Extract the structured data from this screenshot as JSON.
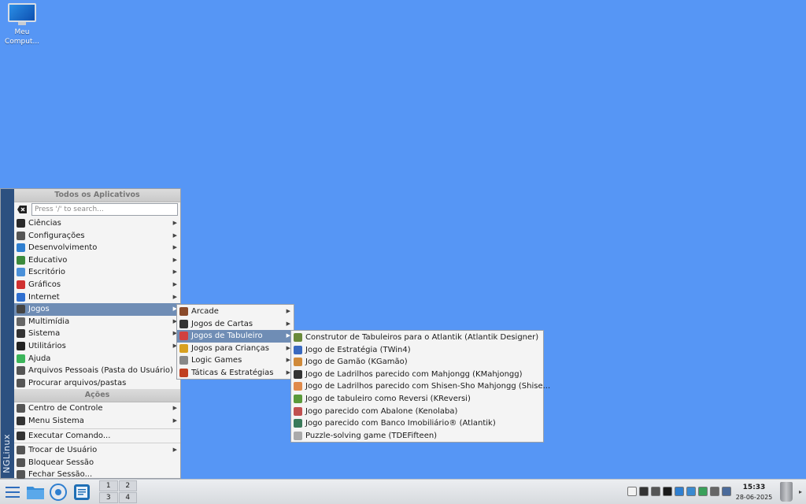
{
  "desktop": {
    "icons": [
      {
        "label": "Meu Comput..."
      }
    ]
  },
  "menu": {
    "brand": "NGLinux",
    "header_apps": "Todos os Aplicativos",
    "search_placeholder": "Press '/' to search...",
    "items": [
      {
        "label": "Ciências",
        "icon": "science-icon",
        "color": "#2a2a2a",
        "submenu": true
      },
      {
        "label": "Configurações",
        "icon": "settings-icon",
        "color": "#555555",
        "submenu": true
      },
      {
        "label": "Desenvolvimento",
        "icon": "development-icon",
        "color": "#2f7fd0",
        "submenu": true
      },
      {
        "label": "Educativo",
        "icon": "education-icon",
        "color": "#3c8a3c",
        "submenu": true
      },
      {
        "label": "Escritório",
        "icon": "office-icon",
        "color": "#4a90d9",
        "submenu": true
      },
      {
        "label": "Gráficos",
        "icon": "graphics-icon",
        "color": "#d03030",
        "submenu": true
      },
      {
        "label": "Internet",
        "icon": "internet-icon",
        "color": "#2f6fd0",
        "submenu": true
      },
      {
        "label": "Jogos",
        "icon": "games-icon",
        "color": "#444444",
        "submenu": true,
        "highlighted": true
      },
      {
        "label": "Multimídia",
        "icon": "multimedia-icon",
        "color": "#666666",
        "submenu": true
      },
      {
        "label": "Sistema",
        "icon": "system-icon",
        "color": "#333333",
        "submenu": true
      },
      {
        "label": "Utilitários",
        "icon": "utilities-icon",
        "color": "#222222",
        "submenu": true
      },
      {
        "label": "Ajuda",
        "icon": "help-icon",
        "color": "#3bb55a",
        "submenu": false
      },
      {
        "label": "Arquivos Pessoais (Pasta do Usuário)",
        "icon": "home-icon",
        "color": "#555555",
        "submenu": false
      },
      {
        "label": "Procurar arquivos/pastas",
        "icon": "find-icon",
        "color": "#555555",
        "submenu": false
      }
    ],
    "header_actions": "Ações",
    "actions": [
      {
        "label": "Centro de Controle",
        "icon": "control-center-icon",
        "color": "#555555",
        "submenu": true
      },
      {
        "label": "Menu Sistema",
        "icon": "system-menu-icon",
        "color": "#333333",
        "submenu": true
      },
      {
        "label": "Executar Comando...",
        "icon": "run-command-icon",
        "color": "#333333",
        "submenu": false
      },
      {
        "label": "Trocar de Usuário",
        "icon": "switch-user-icon",
        "color": "#555555",
        "submenu": true
      },
      {
        "label": "Bloquear Sessão",
        "icon": "lock-icon",
        "color": "#555555",
        "submenu": false
      },
      {
        "label": "Fechar Sessão...",
        "icon": "logout-icon",
        "color": "#555555",
        "submenu": false
      }
    ]
  },
  "games_submenu": [
    {
      "label": "Arcade",
      "icon": "arcade-icon",
      "color": "#8a4a2a"
    },
    {
      "label": "Jogos de Cartas",
      "icon": "cards-icon",
      "color": "#333333"
    },
    {
      "label": "Jogos de Tabuleiro",
      "icon": "board-icon",
      "color": "#d04040",
      "highlighted": true
    },
    {
      "label": "Jogos para Crianças",
      "icon": "kids-icon",
      "color": "#d8a020"
    },
    {
      "label": "Logic Games",
      "icon": "logic-icon",
      "color": "#888888"
    },
    {
      "label": "Táticas & Estratégias",
      "icon": "tactics-icon",
      "color": "#c04020"
    }
  ],
  "board_submenu": [
    {
      "label": "Construtor de Tabuleiros para o Atlantik (Atlantik Designer)",
      "icon": "atlantik-designer-icon",
      "color": "#6a8a3a"
    },
    {
      "label": "Jogo de Estratégia (TWin4)",
      "icon": "twin4-icon",
      "color": "#3a6ac0"
    },
    {
      "label": "Jogo de Gamão (KGamão)",
      "icon": "kgamao-icon",
      "color": "#d08a3a"
    },
    {
      "label": "Jogo de Ladrilhos parecido com Mahjongg (KMahjongg)",
      "icon": "kmahjongg-icon",
      "color": "#333333"
    },
    {
      "label": "Jogo de Ladrilhos parecido com Shisen-Sho Mahjongg (Shise...",
      "icon": "shisen-icon",
      "color": "#e08a4a"
    },
    {
      "label": "Jogo de tabuleiro como Reversi (KReversi)",
      "icon": "kreversi-icon",
      "color": "#5a9a3a"
    },
    {
      "label": "Jogo parecido com Abalone (Kenolaba)",
      "icon": "kenolaba-icon",
      "color": "#c05050"
    },
    {
      "label": "Jogo parecido com Banco Imobiliário® (Atlantik)",
      "icon": "atlantik-icon",
      "color": "#3a7a5a"
    },
    {
      "label": "Puzzle-solving game (TDEFifteen)",
      "icon": "tdefifteen-icon",
      "color": "#aaaaaa"
    }
  ],
  "taskbar": {
    "pager": [
      "1",
      "2",
      "3",
      "4"
    ],
    "tray_icons": [
      {
        "name": "clipboard-icon",
        "color": "#f2f2f2"
      },
      {
        "name": "update-icon",
        "color": "#333333"
      },
      {
        "name": "volume-icon",
        "color": "#555555"
      },
      {
        "name": "terminal-icon",
        "color": "#1a1a1a"
      },
      {
        "name": "network-icon",
        "color": "#2f7fd0"
      },
      {
        "name": "bluetooth-icon",
        "color": "#3a8ad0"
      },
      {
        "name": "monitor-icon",
        "color": "#3aa05a"
      },
      {
        "name": "switch-icon",
        "color": "#666666"
      },
      {
        "name": "printer-icon",
        "color": "#4a6a9a"
      }
    ],
    "time": "15:33",
    "date": "28-06-2025"
  }
}
